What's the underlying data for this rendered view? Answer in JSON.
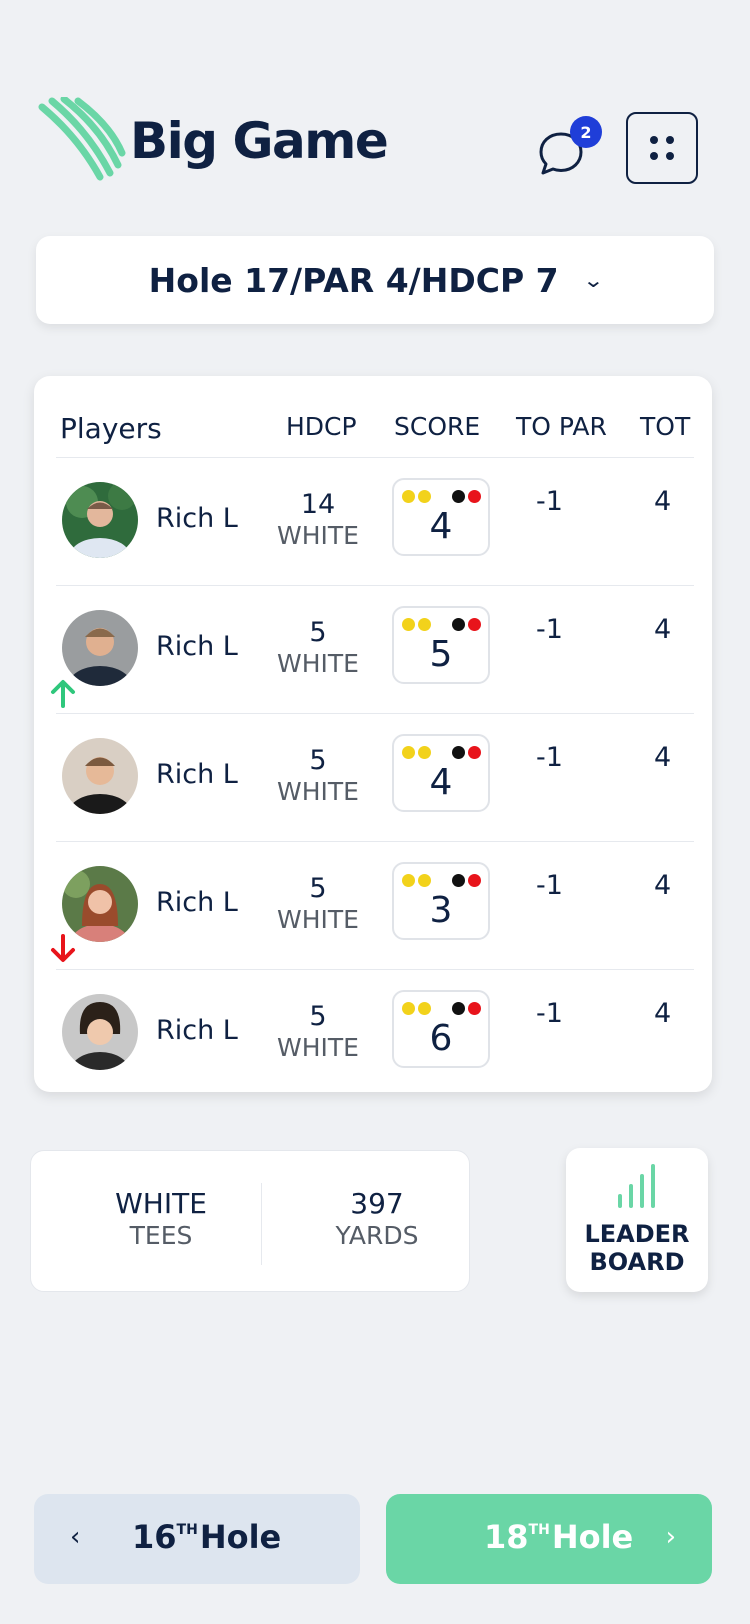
{
  "header": {
    "brand": "Big Game",
    "chat_badge": "2",
    "icons": {
      "chat": "chat-bubble-icon",
      "menu": "grid-dots-icon",
      "logo": "golf-swoosh-icon"
    },
    "colors": {
      "brand": "#0f2142",
      "accent": "#6ad6a6",
      "badge": "#1f3ed8"
    }
  },
  "hole_selector": {
    "label": "Hole 17/PAR 4/HDCP 7",
    "icon": "chevron-down-icon"
  },
  "table": {
    "headers": {
      "players": "Players",
      "hdcp": "HDCP",
      "score": "SCORE",
      "to_par": "TO PAR",
      "tot": "TOT"
    },
    "rows": [
      {
        "name": "Rich L",
        "hdcp": "14",
        "tee": "WHITE",
        "score": "4",
        "to_par": "-1",
        "tot": "4",
        "trend": "none"
      },
      {
        "name": "Rich L",
        "hdcp": "5",
        "tee": "WHITE",
        "score": "5",
        "to_par": "-1",
        "tot": "4",
        "trend": "up"
      },
      {
        "name": "Rich L",
        "hdcp": "5",
        "tee": "WHITE",
        "score": "4",
        "to_par": "-1",
        "tot": "4",
        "trend": "none"
      },
      {
        "name": "Rich L",
        "hdcp": "5",
        "tee": "WHITE",
        "score": "3",
        "to_par": "-1",
        "tot": "4",
        "trend": "down"
      },
      {
        "name": "Rich L",
        "hdcp": "5",
        "tee": "WHITE",
        "score": "6",
        "to_par": "-1",
        "tot": "4",
        "trend": "none"
      }
    ],
    "score_dot_colors": [
      "#f2d21b",
      "#f2d21b",
      "#111111",
      "#e8141b"
    ]
  },
  "tee_info": {
    "tee_value": "WHITE",
    "tee_label": "TEES",
    "yards_value": "397",
    "yards_label": "YARDS"
  },
  "leaderboard": {
    "line1": "LEADER",
    "line2": "BOARD",
    "icon": "bar-chart-icon"
  },
  "nav": {
    "prev_num": "16",
    "prev_suffix": "TH",
    "prev_word": "Hole",
    "next_num": "18",
    "next_suffix": "TH",
    "next_word": "Hole"
  }
}
